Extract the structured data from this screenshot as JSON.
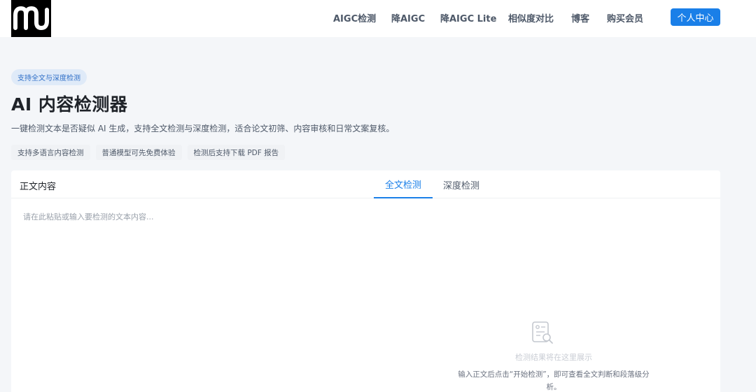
{
  "header": {
    "logo_text": "m",
    "nav": [
      {
        "id": "aigc-detect",
        "label": "AIGC检测"
      },
      {
        "id": "reduce-aigc",
        "label": "降AIGC"
      },
      {
        "id": "reduce-aigc-lite",
        "label": "降AIGC Lite"
      },
      {
        "id": "similarity",
        "label": "相似度对比"
      },
      {
        "id": "blog",
        "label": "博客"
      },
      {
        "id": "membership",
        "label": "购买会员"
      }
    ],
    "user_center_label": "个人中心"
  },
  "hero": {
    "badge": "支持全文与深度检测",
    "title": "AI 内容检测器",
    "subtitle": "一键检测文本是否疑似 AI 生成，支持全文检测与深度检测，适合论文初筛、内容审核和日常文案复核。",
    "features": [
      "支持多语言内容检测",
      "普通模型可先免费体验",
      "检测后支持下载 PDF 报告"
    ]
  },
  "panel": {
    "label": "正文内容",
    "tabs": {
      "full": "全文检测",
      "deep": "深度检测"
    },
    "input_placeholder": "请在此粘贴或输入要检测的文本内容...",
    "result_icon": "document-search-icon",
    "result_title": "检测结果将在这里展示",
    "result_desc": "输入正文后点击“开始检测”，即可查看全文判断和段落级分析。"
  },
  "colors": {
    "accent": "#1a7fe8",
    "page_bg": "#f4f6f9",
    "badge_bg": "#dfeaf8"
  }
}
